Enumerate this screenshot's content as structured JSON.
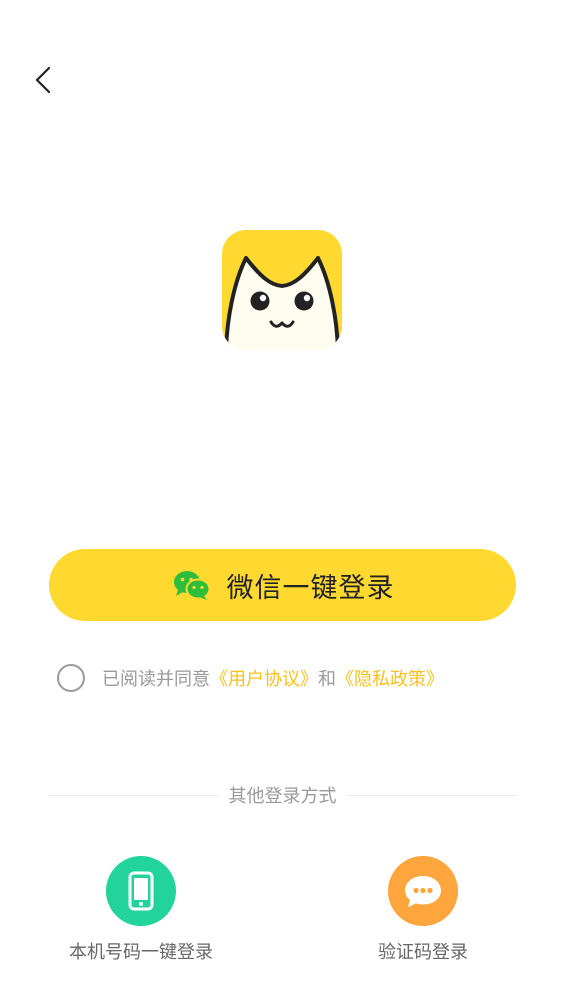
{
  "header": {
    "back_icon": "chevron-left-icon"
  },
  "logo": {
    "icon": "cat-face-logo",
    "colors": {
      "background": "#FFD92F",
      "face": "#FFFDF0",
      "outline": "#222222"
    }
  },
  "wechat_login": {
    "label": "微信一键登录",
    "icon": "wechat-icon",
    "color": "#FFD92F"
  },
  "agreement": {
    "prefix": "已阅读并同意",
    "user_agreement": "《用户协议》",
    "conjunction": "和",
    "privacy_policy": "《隐私政策》",
    "link_color": "#F9C21E"
  },
  "other_login": {
    "title": "其他登录方式",
    "options": [
      {
        "label": "本机号码一键登录",
        "icon": "phone-icon",
        "color": "#22D49A"
      },
      {
        "label": "验证码登录",
        "icon": "chat-bubble-icon",
        "color": "#FFA53E"
      }
    ]
  }
}
